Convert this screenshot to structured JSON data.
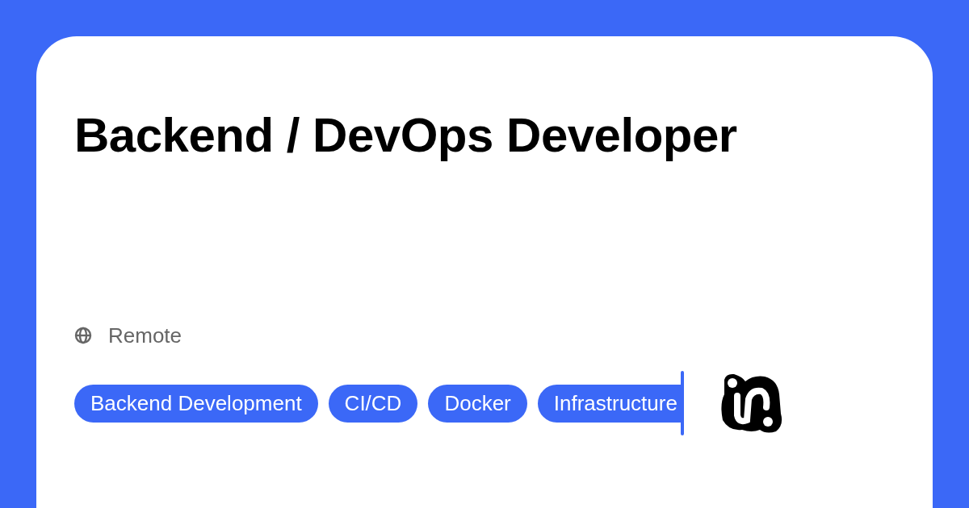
{
  "job": {
    "title": "Backend / DevOps Developer",
    "location": "Remote"
  },
  "tags": [
    {
      "label": "Backend Development"
    },
    {
      "label": "CI/CD"
    },
    {
      "label": "Docker"
    },
    {
      "label": "Infrastructure"
    }
  ]
}
